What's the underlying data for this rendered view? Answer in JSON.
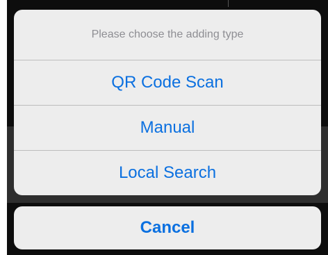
{
  "action_sheet": {
    "title": "Please choose the adding type",
    "options": [
      {
        "label": "QR Code Scan"
      },
      {
        "label": "Manual"
      },
      {
        "label": "Local Search"
      }
    ],
    "cancel_label": "Cancel"
  },
  "colors": {
    "sheet_background": "#ededed",
    "action_blue": "#0b70e0",
    "title_gray": "#8e8e93",
    "separator": "#bdbdbd",
    "backdrop": "#0d0d0d"
  }
}
